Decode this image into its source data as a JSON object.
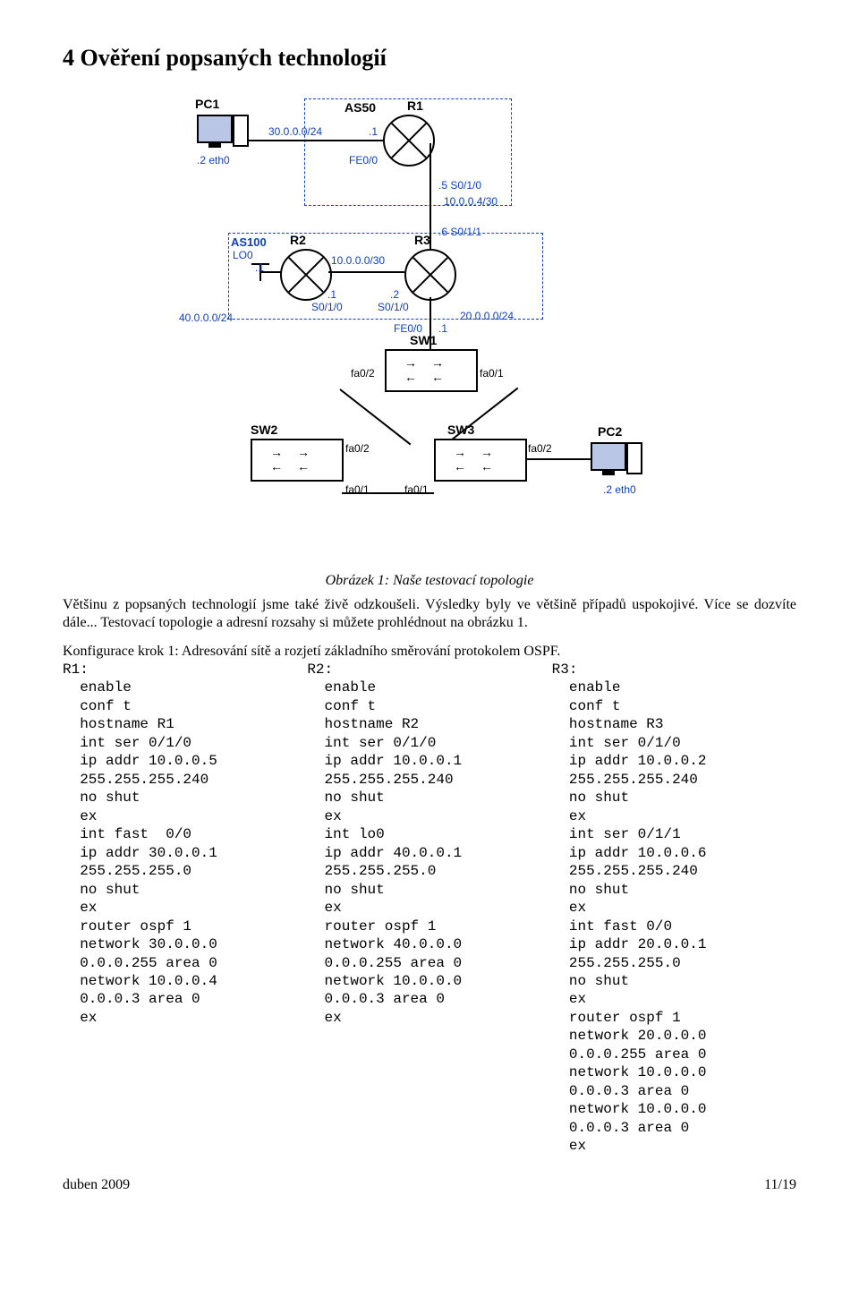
{
  "heading": "4  Ověření popsaných technologií",
  "caption": "Obrázek 1: Naše testovací topologie",
  "para1": "Většinu z popsaných technologií jsme také živě odzkoušeli. Výsledky byly ve většině případů uspokojivé. Více se dozvíte dále... Testovací topologie a adresní rozsahy si můžete prohlédnout na obrázku 1.",
  "para2": "Konfigurace krok 1: Adresování sítě a rozjetí základního směrování protokolem OSPF.",
  "cols": {
    "r1": {
      "head": "R1:",
      "body": "  enable\n  conf t\n  hostname R1\n  int ser 0/1/0\n  ip addr 10.0.0.5\n  255.255.255.240\n  no shut\n  ex\n  int fast  0/0\n  ip addr 30.0.0.1\n  255.255.255.0\n  no shut\n  ex\n  router ospf 1\n  network 30.0.0.0\n  0.0.0.255 area 0\n  network 10.0.0.4\n  0.0.0.3 area 0\n  ex"
    },
    "r2": {
      "head": "R2:",
      "body": "  enable\n  conf t\n  hostname R2\n  int ser 0/1/0\n  ip addr 10.0.0.1\n  255.255.255.240\n  no shut\n  ex\n  int lo0\n  ip addr 40.0.0.1\n  255.255.255.0\n  no shut\n  ex\n  router ospf 1\n  network 40.0.0.0\n  0.0.0.255 area 0\n  network 10.0.0.0\n  0.0.0.3 area 0\n  ex"
    },
    "r3": {
      "head": "R3:",
      "body": "  enable\n  conf t\n  hostname R3\n  int ser 0/1/0\n  ip addr 10.0.0.2\n  255.255.255.240\n  no shut\n  ex\n  int ser 0/1/1\n  ip addr 10.0.0.6\n  255.255.255.240\n  no shut\n  ex\n  int fast 0/0\n  ip addr 20.0.0.1\n  255.255.255.0\n  no shut\n  ex\n  router ospf 1\n  network 20.0.0.0\n  0.0.0.255 area 0\n  network 10.0.0.0\n  0.0.0.3 area 0\n  network 10.0.0.0\n  0.0.0.3 area 0\n  ex"
    }
  },
  "footer": {
    "left": "duben 2009",
    "right": "11/19"
  },
  "diagram": {
    "pc1": "PC1",
    "pc2": "PC2",
    "r1": "R1",
    "r2": "R2",
    "r3": "R3",
    "sw1": "SW1",
    "sw2": "SW2",
    "sw3": "SW3",
    "as50": "AS50",
    "as100": "AS100",
    "lo0": "LO0",
    "net30": "30.0.0.0/24",
    "net10_4": "10.0.0.4/30",
    "net10_0": "10.0.0.0/30",
    "net40": "40.0.0.0/24",
    "net20": "20.0.0.0/24",
    "p_dot1": ".1",
    "p_dot2": ".2",
    "p_dot5": ".5",
    "p_dot6": ".6",
    "p_eth0_2": ".2 eth0",
    "fe00": "FE0/0",
    "s010": "S0/1/0",
    "s011": "S0/1/1",
    "fa01": "fa0/1",
    "fa02": "fa0/2"
  }
}
